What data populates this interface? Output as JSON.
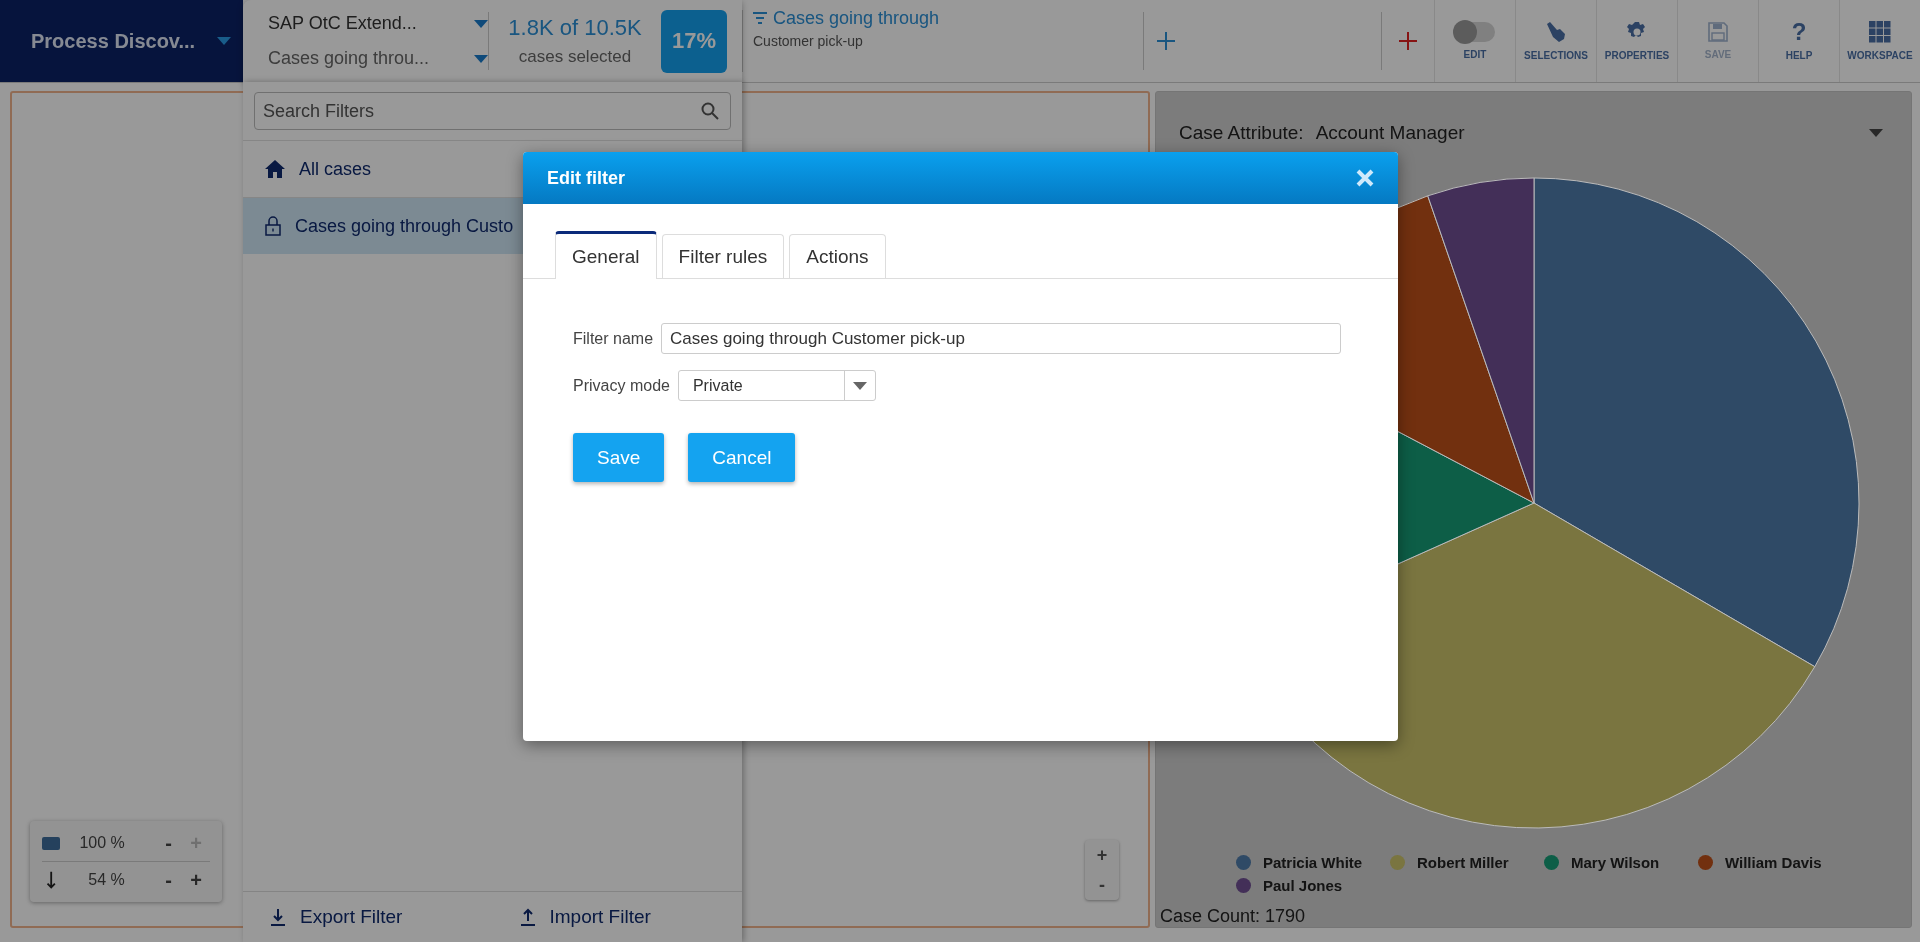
{
  "app_menu": {
    "label": "Process Discov..."
  },
  "dataset": {
    "name": "SAP OtC Extend...",
    "filter": "Cases going throu..."
  },
  "selection": {
    "count": "1.8K of 10.5K",
    "caption": "cases selected",
    "percent": "17%"
  },
  "active_filter": {
    "title": "Cases going through",
    "subtitle": "Customer pick-up"
  },
  "toolbar": [
    {
      "label": "EDIT",
      "kind": "toggle",
      "on": false,
      "disabled": false
    },
    {
      "label": "SELECTIONS",
      "kind": "hand",
      "disabled": false
    },
    {
      "label": "PROPERTIES",
      "kind": "gear",
      "disabled": false
    },
    {
      "label": "SAVE",
      "kind": "save",
      "disabled": true
    },
    {
      "label": "HELP",
      "kind": "help",
      "glyph": "?",
      "disabled": false
    },
    {
      "label": "WORKSPACE",
      "kind": "grid",
      "disabled": false
    }
  ],
  "filter_panel": {
    "search_placeholder": "Search Filters",
    "items": [
      {
        "label": "All cases",
        "kind": "home",
        "selected": false
      },
      {
        "label": "Cases going through Custo",
        "kind": "lock",
        "selected": true
      }
    ],
    "footer": [
      {
        "label": "Export Filter",
        "kind": "export"
      },
      {
        "label": "Import Filter",
        "kind": "import"
      }
    ]
  },
  "zoom_control": [
    {
      "kind": "color",
      "value": "100 %",
      "minus": "-",
      "plus": "+",
      "plus_disabled": true
    },
    {
      "kind": "arrow",
      "value": "54 %",
      "minus": "-",
      "plus": "+",
      "plus_disabled": false
    }
  ],
  "map_zoom": [
    "+",
    "-"
  ],
  "chart_panel": {
    "attribute_label": "Case Attribute:",
    "attribute_value": "Account Manager",
    "legend": [
      {
        "name": "Patricia White",
        "color": "#2f4a66"
      },
      {
        "name": "Robert Miller",
        "color": "#7a7540"
      },
      {
        "name": "Mary Wilson",
        "color": "#0d5e47"
      },
      {
        "name": "William Davis",
        "color": "#72300f"
      },
      {
        "name": "Paul Jones",
        "color": "#432f58"
      }
    ],
    "case_count": "Case Count: 1790"
  },
  "dialog": {
    "title": "Edit filter",
    "tabs": [
      {
        "label": "General",
        "selected": true
      },
      {
        "label": "Filter rules",
        "selected": false
      },
      {
        "label": "Actions",
        "selected": false
      }
    ],
    "filter_name_label": "Filter name",
    "filter_name": "Cases going through Customer pick-up",
    "privacy_label": "Privacy mode",
    "privacy_value": "Private",
    "buttons": [
      "Save",
      "Cancel"
    ]
  }
}
